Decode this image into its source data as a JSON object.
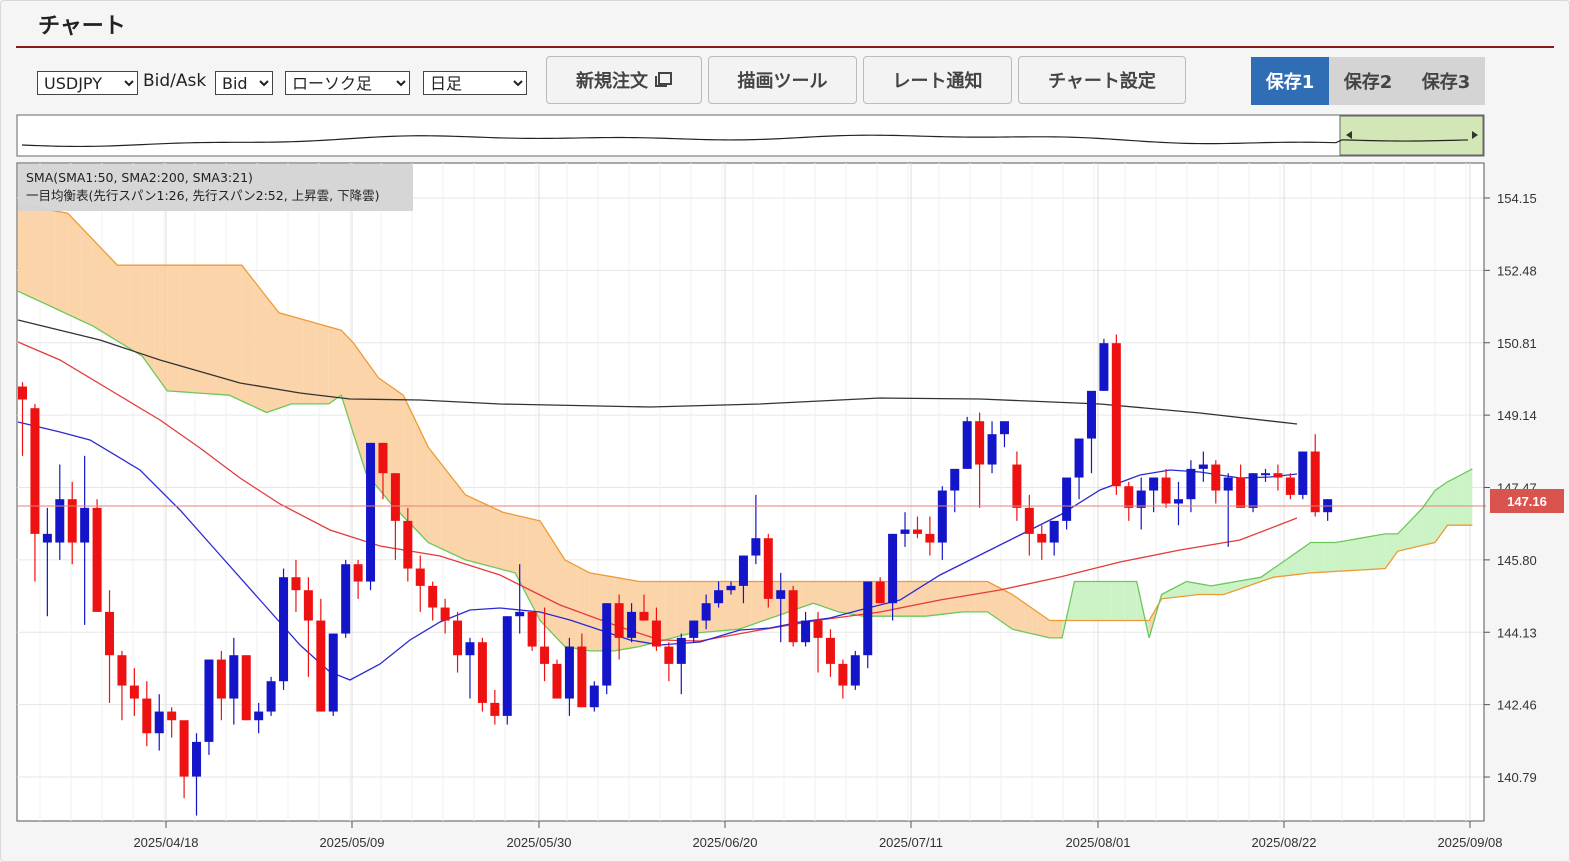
{
  "panel": {
    "title": "チャート"
  },
  "toolbar": {
    "symbol": "USDJPY",
    "bidask_label": "Bid/Ask",
    "price_side": "Bid",
    "chart_type": "ローソク足",
    "timeframe": "日足",
    "new_order_label": "新規注文",
    "drawing_tools_label": "描画ツール",
    "rate_alert_label": "レート通知",
    "chart_settings_label": "チャート設定",
    "saves": [
      {
        "label": "保存1",
        "active": true
      },
      {
        "label": "保存2",
        "active": false
      },
      {
        "label": "保存3",
        "active": false
      }
    ]
  },
  "chart": {
    "legend_line1": "SMA(SMA1:50, SMA2:200, SMA3:21)",
    "legend_line2": "一目均衡表(先行スパン1:26, 先行スパン2:52, 上昇雲, 下降雲)",
    "y_ticks": [
      "154.15",
      "152.48",
      "150.81",
      "149.14",
      "147.47",
      "145.80",
      "144.13",
      "142.46",
      "140.79"
    ],
    "x_ticks": [
      "2025/04/18",
      "2025/05/09",
      "2025/05/30",
      "2025/06/20",
      "2025/07/11",
      "2025/08/01",
      "2025/08/22",
      "2025/09/08"
    ],
    "current_price": "147.16",
    "colors": {
      "up": "#1414c8",
      "down": "#ee1111",
      "sma_long": "#333333",
      "sma_mid": "#e53b3b",
      "sma_short": "#2a2ad0",
      "kumo_down": "#fbd2a4",
      "kumo_up": "#c9f2c2",
      "span1": "#6cc85a",
      "span2": "#f09a35",
      "price_tag": "#d9534f"
    }
  },
  "chart_data": {
    "type": "candlestick",
    "symbol": "USDJPY",
    "timeframe": "日足",
    "ylim": [
      140.0,
      155.0
    ],
    "ohlc_start_date": "2025/04/04",
    "ohlc": [
      [
        149.8,
        149.9,
        148.2,
        149.5
      ],
      [
        149.3,
        149.4,
        145.3,
        146.4
      ],
      [
        146.2,
        147.0,
        144.5,
        146.4
      ],
      [
        146.2,
        148.0,
        145.8,
        147.2
      ],
      [
        147.2,
        147.6,
        145.7,
        146.2
      ],
      [
        146.2,
        148.2,
        144.3,
        147.0
      ],
      [
        147.0,
        147.2,
        144.6,
        144.6
      ],
      [
        144.6,
        145.1,
        142.5,
        143.6
      ],
      [
        143.6,
        143.7,
        142.1,
        142.9
      ],
      [
        142.9,
        143.3,
        142.2,
        142.6
      ],
      [
        142.6,
        143.0,
        141.5,
        141.8
      ],
      [
        141.8,
        142.7,
        141.4,
        142.3
      ],
      [
        142.3,
        142.4,
        141.7,
        142.1
      ],
      [
        142.1,
        142.0,
        140.3,
        140.8
      ],
      [
        140.8,
        141.8,
        139.9,
        141.6
      ],
      [
        141.6,
        143.5,
        141.3,
        143.5
      ],
      [
        143.5,
        143.7,
        142.1,
        142.6
      ],
      [
        142.6,
        144.0,
        142.0,
        143.6
      ],
      [
        143.6,
        143.6,
        142.1,
        142.1
      ],
      [
        142.1,
        142.5,
        141.8,
        142.3
      ],
      [
        142.3,
        143.1,
        142.2,
        143.0
      ],
      [
        143.0,
        145.6,
        142.8,
        145.4
      ],
      [
        145.4,
        145.8,
        144.6,
        145.1
      ],
      [
        145.1,
        145.4,
        143.1,
        144.4
      ],
      [
        144.4,
        144.9,
        142.3,
        142.3
      ],
      [
        142.3,
        144.1,
        142.2,
        144.1
      ],
      [
        144.1,
        145.8,
        144.0,
        145.7
      ],
      [
        145.7,
        145.8,
        144.9,
        145.3
      ],
      [
        145.3,
        148.5,
        145.1,
        148.5
      ],
      [
        148.5,
        148.5,
        147.2,
        147.8
      ],
      [
        147.8,
        147.8,
        145.8,
        146.7
      ],
      [
        146.7,
        147.0,
        145.3,
        145.6
      ],
      [
        145.6,
        145.9,
        144.6,
        145.2
      ],
      [
        145.2,
        145.3,
        144.4,
        144.7
      ],
      [
        144.7,
        144.9,
        144.1,
        144.4
      ],
      [
        144.4,
        144.6,
        143.2,
        143.6
      ],
      [
        143.6,
        144.0,
        142.6,
        143.9
      ],
      [
        143.9,
        144.0,
        142.3,
        142.5
      ],
      [
        142.5,
        142.8,
        142.0,
        142.2
      ],
      [
        142.2,
        144.5,
        142.0,
        144.5
      ],
      [
        144.5,
        145.7,
        144.1,
        144.6
      ],
      [
        144.6,
        144.6,
        143.7,
        143.8
      ],
      [
        143.8,
        144.7,
        143.0,
        143.4
      ],
      [
        143.4,
        143.5,
        142.6,
        142.6
      ],
      [
        142.6,
        144.0,
        142.2,
        143.8
      ],
      [
        143.8,
        144.1,
        142.4,
        142.4
      ],
      [
        142.4,
        143.0,
        142.3,
        142.9
      ],
      [
        142.9,
        144.8,
        142.7,
        144.8
      ],
      [
        144.8,
        145.0,
        143.5,
        144.0
      ],
      [
        144.0,
        144.8,
        143.9,
        144.6
      ],
      [
        144.6,
        145.0,
        144.4,
        144.4
      ],
      [
        144.4,
        144.7,
        143.7,
        143.8
      ],
      [
        143.8,
        143.9,
        143.0,
        143.4
      ],
      [
        143.4,
        144.1,
        142.7,
        144.0
      ],
      [
        144.0,
        144.4,
        143.9,
        144.4
      ],
      [
        144.4,
        145.0,
        144.2,
        144.8
      ],
      [
        144.8,
        145.3,
        144.7,
        145.1
      ],
      [
        145.1,
        145.3,
        145.0,
        145.2
      ],
      [
        145.2,
        145.9,
        144.8,
        145.9
      ],
      [
        145.9,
        147.3,
        145.7,
        146.3
      ],
      [
        146.3,
        146.4,
        144.7,
        144.9
      ],
      [
        144.9,
        145.5,
        143.9,
        145.1
      ],
      [
        145.1,
        145.2,
        143.8,
        143.9
      ],
      [
        143.9,
        144.6,
        143.8,
        144.4
      ],
      [
        144.4,
        144.6,
        143.2,
        144.0
      ],
      [
        144.0,
        144.2,
        143.1,
        143.4
      ],
      [
        143.4,
        143.5,
        142.6,
        142.9
      ],
      [
        142.9,
        143.7,
        142.8,
        143.6
      ],
      [
        143.6,
        145.2,
        143.3,
        145.3
      ],
      [
        145.3,
        145.4,
        144.8,
        144.8
      ],
      [
        144.8,
        146.4,
        144.4,
        146.4
      ],
      [
        146.4,
        146.9,
        146.1,
        146.5
      ],
      [
        146.5,
        146.8,
        146.3,
        146.4
      ],
      [
        146.4,
        146.8,
        145.9,
        146.2
      ],
      [
        146.2,
        147.5,
        145.8,
        147.4
      ],
      [
        147.4,
        147.6,
        146.9,
        147.9
      ],
      [
        147.9,
        149.1,
        147.9,
        149.0
      ],
      [
        149.0,
        149.2,
        147.0,
        148.0
      ],
      [
        148.0,
        149.0,
        147.8,
        148.7
      ],
      [
        148.7,
        148.9,
        148.4,
        149.0
      ],
      [
        148.0,
        148.3,
        146.7,
        147.0
      ],
      [
        147.0,
        147.3,
        145.9,
        146.4
      ],
      [
        146.4,
        146.6,
        145.8,
        146.2
      ],
      [
        146.2,
        146.5,
        145.9,
        146.7
      ],
      [
        146.7,
        147.6,
        146.5,
        147.7
      ],
      [
        147.7,
        148.5,
        147.2,
        148.6
      ],
      [
        148.6,
        149.5,
        147.8,
        149.7
      ],
      [
        149.7,
        150.9,
        149.7,
        150.8
      ],
      [
        150.8,
        151.0,
        147.3,
        147.5
      ],
      [
        147.5,
        147.6,
        146.7,
        147.0
      ],
      [
        147.0,
        147.7,
        146.5,
        147.4
      ],
      [
        147.4,
        147.7,
        146.9,
        147.7
      ],
      [
        147.7,
        147.9,
        147.0,
        147.1
      ],
      [
        147.1,
        147.6,
        146.6,
        147.2
      ],
      [
        147.2,
        148.1,
        146.9,
        147.9
      ],
      [
        147.9,
        148.3,
        147.6,
        148.0
      ],
      [
        148.0,
        148.1,
        147.1,
        147.4
      ],
      [
        147.4,
        147.8,
        146.1,
        147.7
      ],
      [
        147.7,
        148.0,
        147.0,
        147.0
      ],
      [
        147.0,
        147.8,
        146.9,
        147.8
      ],
      [
        147.8,
        147.9,
        147.6,
        147.8
      ],
      [
        147.8,
        148.0,
        147.4,
        147.7
      ],
      [
        147.7,
        147.8,
        147.2,
        147.3
      ],
      [
        147.3,
        148.3,
        147.2,
        148.3
      ],
      [
        148.3,
        148.7,
        146.8,
        146.9
      ],
      [
        146.9,
        147.2,
        146.7,
        147.2
      ]
    ],
    "sma_series": [
      {
        "name": "SMA1:50",
        "values": [
          145.7,
          144.0,
          144.0,
          144.8,
          145.4,
          146.5,
          147.3
        ]
      },
      {
        "name": "SMA2:200",
        "values": [
          151.5,
          150.5,
          149.5,
          149.2,
          149.2,
          149.2,
          149.2,
          148.9
        ]
      },
      {
        "name": "SMA3:21",
        "values": [
          149.0,
          148.5,
          145.0,
          142.8,
          143.5,
          144.8,
          144.3,
          145.0,
          147.3,
          148.0
        ]
      }
    ]
  }
}
